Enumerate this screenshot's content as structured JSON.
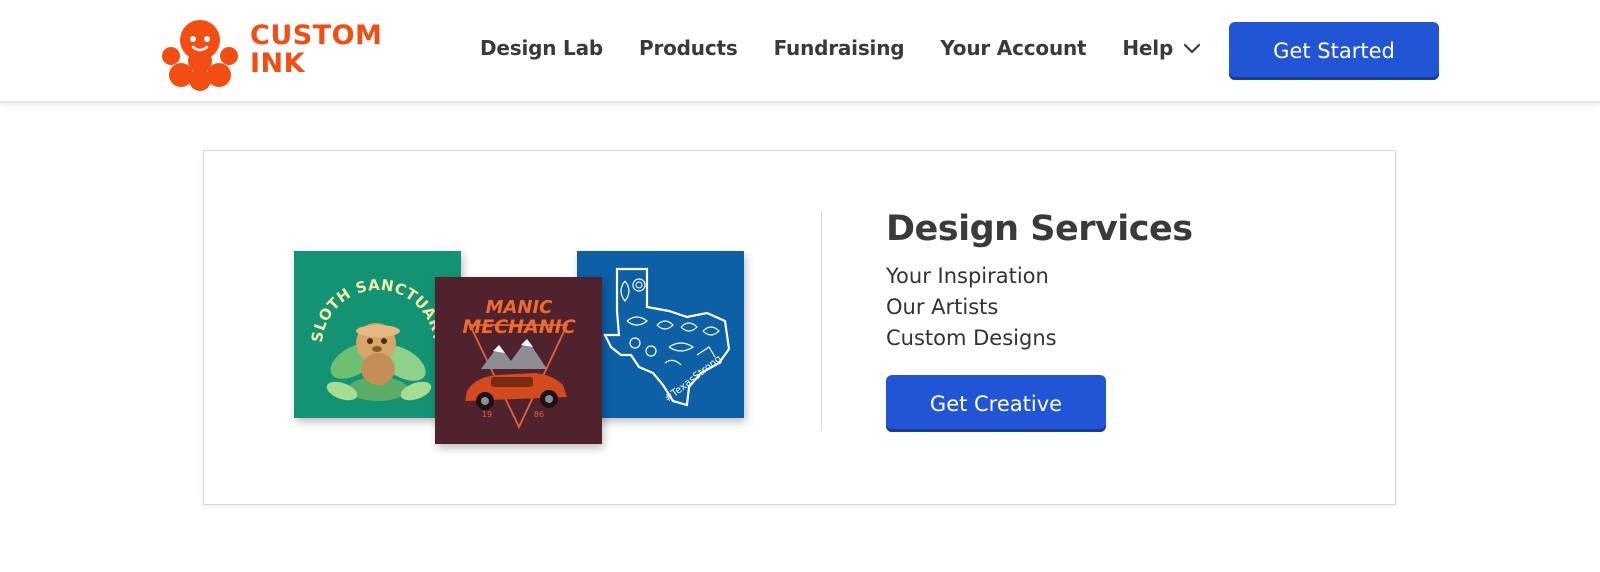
{
  "brand": {
    "logo_line1": "CUSTOM",
    "logo_line2": "INK",
    "logo_color": "#f24e14"
  },
  "nav": {
    "items": [
      {
        "label": "Design Lab"
      },
      {
        "label": "Products"
      },
      {
        "label": "Fundraising"
      },
      {
        "label": "Your Account"
      },
      {
        "label": "Help",
        "icon": "chevron-down-icon"
      }
    ],
    "cta_label": "Get Started"
  },
  "promo": {
    "title": "Design Services",
    "lines": [
      "Your Inspiration",
      "Our Artists",
      "Custom Designs"
    ],
    "cta_label": "Get Creative",
    "tees": [
      {
        "name": "sloth-sanctuary",
        "text": "SLOTH SANCTUARY",
        "bg": "#139274"
      },
      {
        "name": "manic-mechanic",
        "text_line1": "MANIC",
        "text_line2": "MECHANIC",
        "year_left": "19",
        "year_right": "86",
        "bg": "#4f222d"
      },
      {
        "name": "texas-strong",
        "text": "#TexasStrong",
        "bg": "#0d5fa6"
      }
    ]
  },
  "colors": {
    "accent": "#2255d6",
    "accent_dark": "#163b99"
  }
}
